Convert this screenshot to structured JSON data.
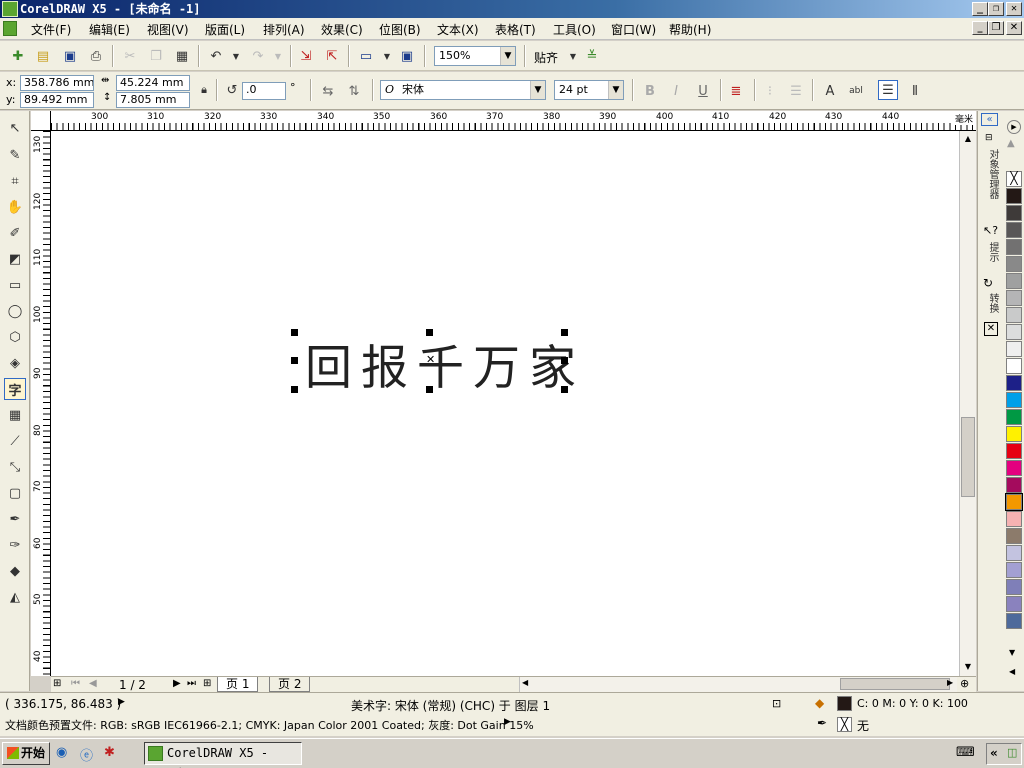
{
  "window": {
    "title": "CorelDRAW X5 - [未命名 -1]",
    "btn_minimize": "_",
    "btn_restore": "❐",
    "btn_close": "✕"
  },
  "menu": {
    "items": [
      "文件(F)",
      "编辑(E)",
      "视图(V)",
      "版面(L)",
      "排列(A)",
      "效果(C)",
      "位图(B)",
      "文本(X)",
      "表格(T)",
      "工具(O)",
      "窗口(W)",
      "帮助(H)"
    ]
  },
  "toolbar": {
    "zoom": "150%",
    "snap_label": "贴齐"
  },
  "propbar": {
    "x_label": "x:",
    "y_label": "y:",
    "x": "358.786 mm",
    "y": "89.492 mm",
    "w": "45.224 mm",
    "h": "7.805 mm",
    "rotation": ".0",
    "rotation_unit": "°",
    "font_name": "宋体",
    "font_size": "24 pt",
    "bold": "B",
    "italic": "I",
    "underline": "U"
  },
  "ruler": {
    "unit": "毫米",
    "h_ticks": [
      "300",
      "310",
      "320",
      "330",
      "340",
      "350",
      "360",
      "370",
      "380",
      "390",
      "400",
      "410",
      "420",
      "430",
      "440"
    ],
    "v_ticks": [
      "130",
      "120",
      "110",
      "100",
      "90",
      "80",
      "70",
      "60",
      "50",
      "40"
    ]
  },
  "canvas": {
    "text": "回报千万家"
  },
  "pages": {
    "counter": "1 / 2",
    "tabs": [
      "页 1",
      "页 2"
    ]
  },
  "dockers": {
    "object_manager": "对象管理器",
    "hints": "提示",
    "transform": "转换"
  },
  "palette": {
    "colors": [
      "#231815",
      "#3e3a39",
      "#595757",
      "#727171",
      "#898989",
      "#9fa0a0",
      "#b5b5b6",
      "#c9caca",
      "#dcdddd",
      "#efefef",
      "#ffffff",
      "#1d2088",
      "#00a0e9",
      "#009944",
      "#fff100",
      "#e60012",
      "#e4007f",
      "#a40b5d",
      "#f39800",
      "#f5b2b2",
      "#8c7b6b",
      "#c3c3e0",
      "#a3a0d2",
      "#7f7fb8",
      "#8a82be",
      "#4e6a9b"
    ]
  },
  "status": {
    "coords": "( 336.175, 86.483 )",
    "object_info": "美术字: 宋体 (常规) (CHC) 于 图层 1",
    "fill_color": "C: 0 M: 0 Y: 0 K: 100",
    "fill_swatch": "#231815",
    "outline": "无",
    "color_profile": "文档颜色预置文件: RGB: sRGB IEC61966-2.1; CMYK: Japan Color 2001 Coated; 灰度: Dot Gain 15%"
  },
  "taskbar": {
    "start": "开始",
    "task": "CorelDRAW X5 - [未..."
  }
}
